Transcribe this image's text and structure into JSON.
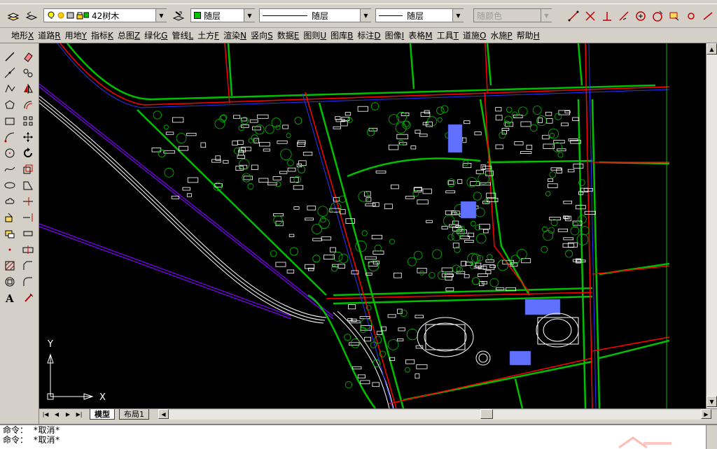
{
  "layer_toolbar": {
    "current_layer": "42树木",
    "color": "随层",
    "color_swatch": "#00c000",
    "linetype": "随层",
    "lineweight": "随层",
    "plotstyle": "随颜色"
  },
  "menu": [
    {
      "label": "地形",
      "key": "X"
    },
    {
      "label": "道路",
      "key": "R"
    },
    {
      "label": "用地",
      "key": "Y"
    },
    {
      "label": "指标",
      "key": "K"
    },
    {
      "label": "总图",
      "key": "Z"
    },
    {
      "label": "绿化",
      "key": "G"
    },
    {
      "label": "管线",
      "key": "L"
    },
    {
      "label": "土方",
      "key": "F"
    },
    {
      "label": "渲染",
      "key": "N"
    },
    {
      "label": "竖向",
      "key": "S"
    },
    {
      "label": "数据",
      "key": "E"
    },
    {
      "label": "图则",
      "key": "U"
    },
    {
      "label": "图库",
      "key": "B"
    },
    {
      "label": "标注",
      "key": "D"
    },
    {
      "label": "图像",
      "key": "I"
    },
    {
      "label": "表格",
      "key": "M"
    },
    {
      "label": "工具",
      "key": "T"
    },
    {
      "label": "道施",
      "key": "O"
    },
    {
      "label": "水施",
      "key": "P"
    },
    {
      "label": "帮助",
      "key": "H"
    }
  ],
  "ucs": {
    "x_label": "X",
    "y_label": "Y"
  },
  "tabs": [
    "模型",
    "布局1"
  ],
  "command_lines": [
    "命令：  *取消*",
    "命令：  *取消*"
  ],
  "colors": {
    "road_red": "#ff0000",
    "road_blue": "#3030ff",
    "green": "#00c000",
    "canvas": "#000000"
  },
  "icons": {
    "left": [
      "line-icon",
      "eraser-icon",
      "construction-line-icon",
      "copy-icon",
      "polyline-icon",
      "mirror-icon",
      "polygon-icon",
      "offset-icon",
      "rectangle-icon",
      "array-icon",
      "arc-icon",
      "move-icon",
      "circle-icon",
      "rotate-icon",
      "spline-icon",
      "scale-icon",
      "ellipse-icon",
      "stretch-icon",
      "revcloud-icon",
      "trim-icon",
      "insert-block-icon",
      "extend-icon",
      "make-block-icon",
      "break-icon",
      "point-icon",
      "break-at-point-icon",
      "hatch-icon",
      "chamfer-icon",
      "region-icon",
      "fillet-icon",
      "text-icon",
      "explode-icon"
    ]
  }
}
